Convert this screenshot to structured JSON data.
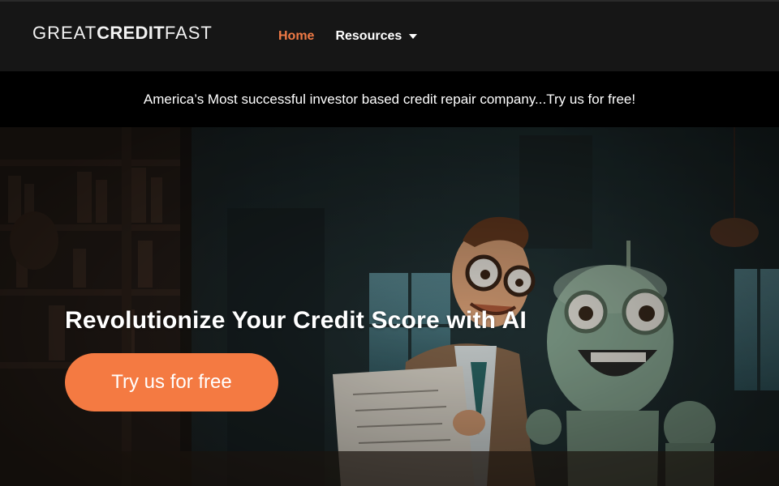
{
  "header": {
    "logo": {
      "part1": "GREAT",
      "part2": "CREDIT",
      "part3": "FAST"
    },
    "nav": [
      {
        "label": "Home",
        "active": true
      },
      {
        "label": "Resources",
        "has_dropdown": true
      }
    ]
  },
  "announcement": {
    "text": "America’s Most successful investor based credit repair company...Try us for free!"
  },
  "hero": {
    "title": "Revolutionize Your Credit Score with AI",
    "cta_label": "Try us for free"
  },
  "colors": {
    "accent": "#f47a42",
    "nav_active": "#f07a45",
    "header_bg": "#161616",
    "announce_bg": "#000000"
  },
  "icons": {
    "dropdown": "caret-down-icon"
  }
}
